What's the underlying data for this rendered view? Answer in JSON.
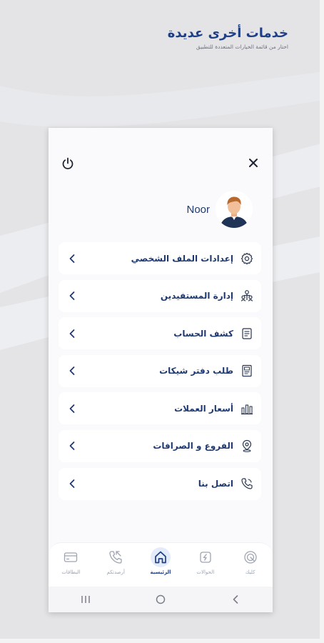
{
  "header": {
    "title": "خدمات أخرى عديدة",
    "subtitle": "اختار من قائمة الخيارات المتعددة للتطبيق"
  },
  "profile": {
    "name": "Noor"
  },
  "menu": {
    "items": [
      {
        "label": "إعدادات الملف الشخصي",
        "icon": "gear-icon"
      },
      {
        "label": "إدارة المستفيدين",
        "icon": "beneficiaries-icon"
      },
      {
        "label": "كشف الحساب",
        "icon": "statement-icon"
      },
      {
        "label": "طلب دفتر شيكات",
        "icon": "checkbook-icon"
      },
      {
        "label": "أسعار العملات",
        "icon": "bar-chart-icon"
      },
      {
        "label": "الفروع و الصرافات",
        "icon": "location-pin-icon"
      },
      {
        "label": "اتصل بنا",
        "icon": "phone-icon"
      }
    ]
  },
  "bottom_nav": {
    "items": [
      {
        "label": "البطاقات",
        "icon": "card-icon"
      },
      {
        "label": "أرصدتكم",
        "icon": "transfer-phone-icon"
      },
      {
        "label": "الرئيسية",
        "icon": "home-icon",
        "active": true
      },
      {
        "label": "الحوالات",
        "icon": "transfer-icon"
      },
      {
        "label": "كليك",
        "icon": "click-icon"
      }
    ]
  },
  "colors": {
    "accent": "#1f3f86",
    "text": "#1f3a72",
    "background": "#e4e4e6"
  }
}
